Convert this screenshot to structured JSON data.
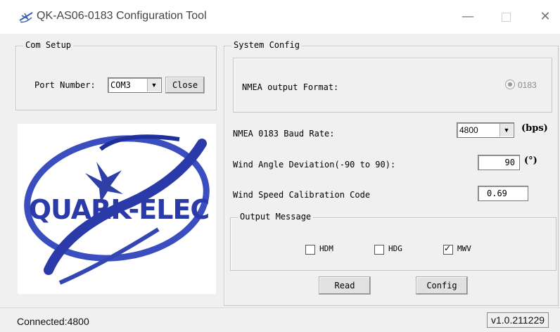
{
  "window": {
    "title": "QK-AS06-0183 Configuration Tool"
  },
  "com_setup": {
    "legend": "Com Setup",
    "port_label": "Port Number:",
    "port_value": "COM3",
    "close_label": "Close"
  },
  "logo": {
    "text": "QUARK-ELEC"
  },
  "system_config": {
    "legend": "System Config",
    "nmea_format_label": "NMEA output Format:",
    "nmea_format_option": "0183",
    "baud_label": "NMEA 0183 Baud Rate:",
    "baud_value": "4800",
    "baud_unit": "(bps)",
    "wind_angle_label": "Wind Angle Deviation(-90 to 90):",
    "wind_angle_value": "90",
    "wind_angle_unit": "(°)",
    "wind_speed_label": "Wind Speed Calibration Code",
    "wind_speed_value": "0.69"
  },
  "output_message": {
    "legend": "Output Message",
    "options": [
      {
        "label": "HDM",
        "checked": false
      },
      {
        "label": "HDG",
        "checked": false
      },
      {
        "label": "MWV",
        "checked": true
      }
    ]
  },
  "actions": {
    "read_label": "Read",
    "config_label": "Config"
  },
  "status": {
    "connection": "Connected:4800",
    "version": "v1.0.211229"
  }
}
